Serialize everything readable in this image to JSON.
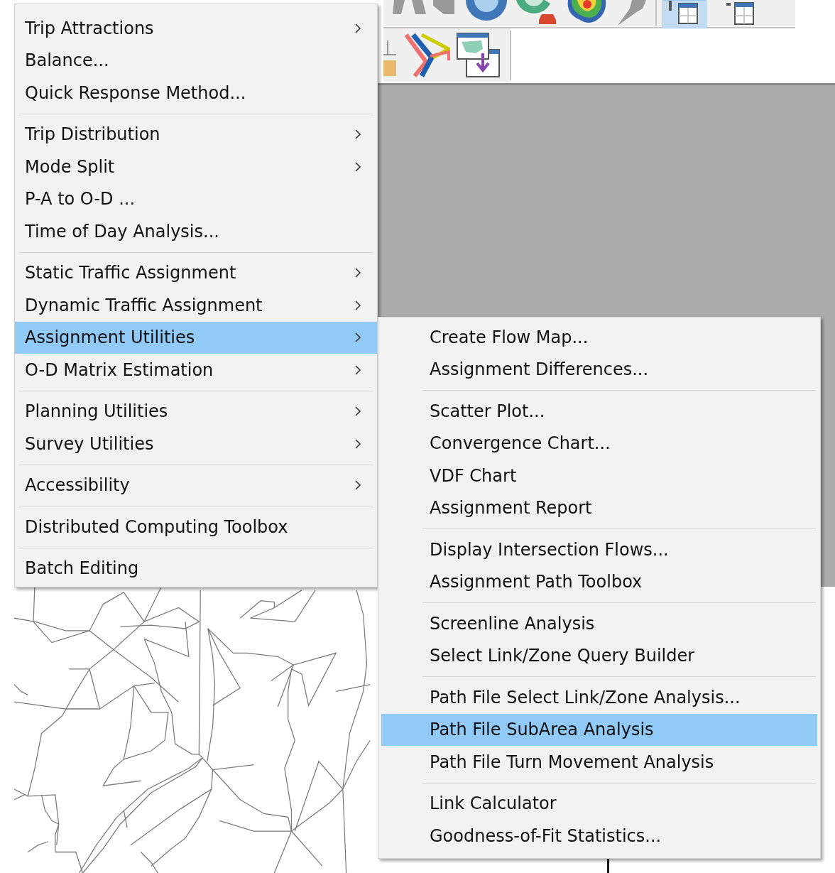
{
  "main_menu": {
    "groups": [
      {
        "items": [
          {
            "label": "Trip Attractions",
            "submenu": true,
            "selected": false
          },
          {
            "label": "Balance...",
            "submenu": false,
            "selected": false
          },
          {
            "label": "Quick Response Method...",
            "submenu": false,
            "selected": false
          }
        ]
      },
      {
        "items": [
          {
            "label": "Trip Distribution",
            "submenu": true,
            "selected": false
          },
          {
            "label": "Mode Split",
            "submenu": true,
            "selected": false
          },
          {
            "label": "P-A to O-D ...",
            "submenu": false,
            "selected": false
          },
          {
            "label": "Time of Day Analysis...",
            "submenu": false,
            "selected": false
          }
        ]
      },
      {
        "items": [
          {
            "label": "Static Traffic Assignment",
            "submenu": true,
            "selected": false
          },
          {
            "label": "Dynamic Traffic Assignment",
            "submenu": true,
            "selected": false
          },
          {
            "label": "Assignment Utilities",
            "submenu": true,
            "selected": true
          },
          {
            "label": "O-D Matrix Estimation",
            "submenu": true,
            "selected": false
          }
        ]
      },
      {
        "items": [
          {
            "label": "Planning Utilities",
            "submenu": true,
            "selected": false
          },
          {
            "label": "Survey Utilities",
            "submenu": true,
            "selected": false
          }
        ]
      },
      {
        "items": [
          {
            "label": "Accessibility",
            "submenu": true,
            "selected": false
          }
        ]
      },
      {
        "items": [
          {
            "label": "Distributed Computing Toolbox",
            "submenu": false,
            "selected": false
          }
        ]
      },
      {
        "items": [
          {
            "label": "Batch Editing",
            "submenu": false,
            "selected": false
          }
        ]
      }
    ]
  },
  "submenu": {
    "groups": [
      {
        "items": [
          {
            "label": "Create Flow Map...",
            "selected": false
          },
          {
            "label": "Assignment Differences...",
            "selected": false
          }
        ]
      },
      {
        "items": [
          {
            "label": "Scatter Plot...",
            "selected": false
          },
          {
            "label": "Convergence Chart...",
            "selected": false
          },
          {
            "label": "VDF Chart",
            "selected": false
          },
          {
            "label": "Assignment Report",
            "selected": false
          }
        ]
      },
      {
        "items": [
          {
            "label": "Display Intersection Flows...",
            "selected": false
          },
          {
            "label": "Assignment Path Toolbox",
            "selected": false
          }
        ]
      },
      {
        "items": [
          {
            "label": "Screenline Analysis",
            "selected": false
          },
          {
            "label": "Select Link/Zone Query Builder",
            "selected": false
          }
        ]
      },
      {
        "items": [
          {
            "label": "Path File Select Link/Zone Analysis...",
            "selected": false
          },
          {
            "label": "Path File SubArea Analysis",
            "selected": true
          },
          {
            "label": "Path File Turn Movement Analysis",
            "selected": false
          }
        ]
      },
      {
        "items": [
          {
            "label": "Link Calculator",
            "selected": false
          },
          {
            "label": "Goodness-of-Fit Statistics...",
            "selected": false
          }
        ]
      }
    ]
  }
}
